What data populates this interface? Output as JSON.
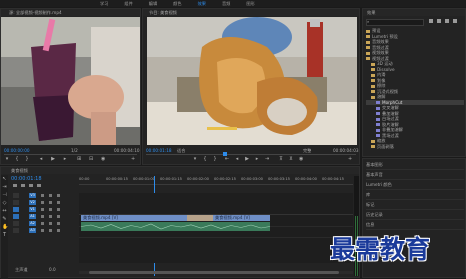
{
  "workspace_tabs": [
    "学习",
    "组件",
    "编辑",
    "颜色",
    "效果",
    "音频",
    "图形"
  ],
  "active_workspace": "效果",
  "source_monitor": {
    "tab": "源: 全部视频-视频制作.mp4",
    "timecode_in": "00:00:00:00",
    "timecode_out": "00:00:04:10",
    "fit": "1/2"
  },
  "program_monitor": {
    "tab": "节目: 美食视频",
    "timecode": "00:00:01:18",
    "fit": "适合",
    "quality": "完整",
    "duration": "00:00:04:03"
  },
  "effects_panel": {
    "title": "效果",
    "search_placeholder": "",
    "tree": [
      {
        "label": "预设",
        "indent": 0,
        "type": "folder"
      },
      {
        "label": "Lumetri 预设",
        "indent": 0,
        "type": "folder"
      },
      {
        "label": "音频效果",
        "indent": 0,
        "type": "folder"
      },
      {
        "label": "音频过渡",
        "indent": 0,
        "type": "folder"
      },
      {
        "label": "视频效果",
        "indent": 0,
        "type": "folder"
      },
      {
        "label": "视频过渡",
        "indent": 0,
        "type": "folder"
      },
      {
        "label": "3D 运动",
        "indent": 1,
        "type": "folder"
      },
      {
        "label": "Dissolve",
        "indent": 1,
        "type": "folder"
      },
      {
        "label": "内滑",
        "indent": 1,
        "type": "folder"
      },
      {
        "label": "划像",
        "indent": 1,
        "type": "folder"
      },
      {
        "label": "擦除",
        "indent": 1,
        "type": "folder"
      },
      {
        "label": "沉浸式视频",
        "indent": 1,
        "type": "folder"
      },
      {
        "label": "溶解",
        "indent": 1,
        "type": "folder"
      },
      {
        "label": "MorphCut",
        "indent": 2,
        "type": "item",
        "selected": true
      },
      {
        "label": "交叉溶解",
        "indent": 2,
        "type": "item"
      },
      {
        "label": "叠加溶解",
        "indent": 2,
        "type": "item"
      },
      {
        "label": "白场过渡",
        "indent": 2,
        "type": "item"
      },
      {
        "label": "胶片溶解",
        "indent": 2,
        "type": "item"
      },
      {
        "label": "非叠加溶解",
        "indent": 2,
        "type": "item"
      },
      {
        "label": "黑场过渡",
        "indent": 2,
        "type": "item"
      },
      {
        "label": "缩放",
        "indent": 1,
        "type": "folder"
      },
      {
        "label": "页面剥落",
        "indent": 1,
        "type": "folder"
      }
    ]
  },
  "side_panels": [
    "基本图形",
    "基本声音",
    "Lumetri 颜色",
    "库",
    "标记",
    "历史记录",
    "信息"
  ],
  "timeline": {
    "tab": "美食视频",
    "timecode": "00:00:01:18",
    "ruler": [
      "00:00",
      "00:00:00:15",
      "00:00:01:00",
      "00:00:01:15",
      "00:00:02:00",
      "00:00:02:15",
      "00:00:03:00",
      "00:00:03:15",
      "00:00:04:00",
      "00:00:04:15"
    ],
    "video_tracks": [
      "V3",
      "V2",
      "V1"
    ],
    "audio_tracks": [
      "A1",
      "A2",
      "A3"
    ],
    "master": "主声道",
    "master_value": "0.0",
    "clips": [
      {
        "label": "美食视频.mp4 [V]",
        "track": "V1"
      },
      {
        "label": "美食视频.mp4 [V]",
        "track": "V1"
      }
    ]
  },
  "watermark": "最需教育"
}
